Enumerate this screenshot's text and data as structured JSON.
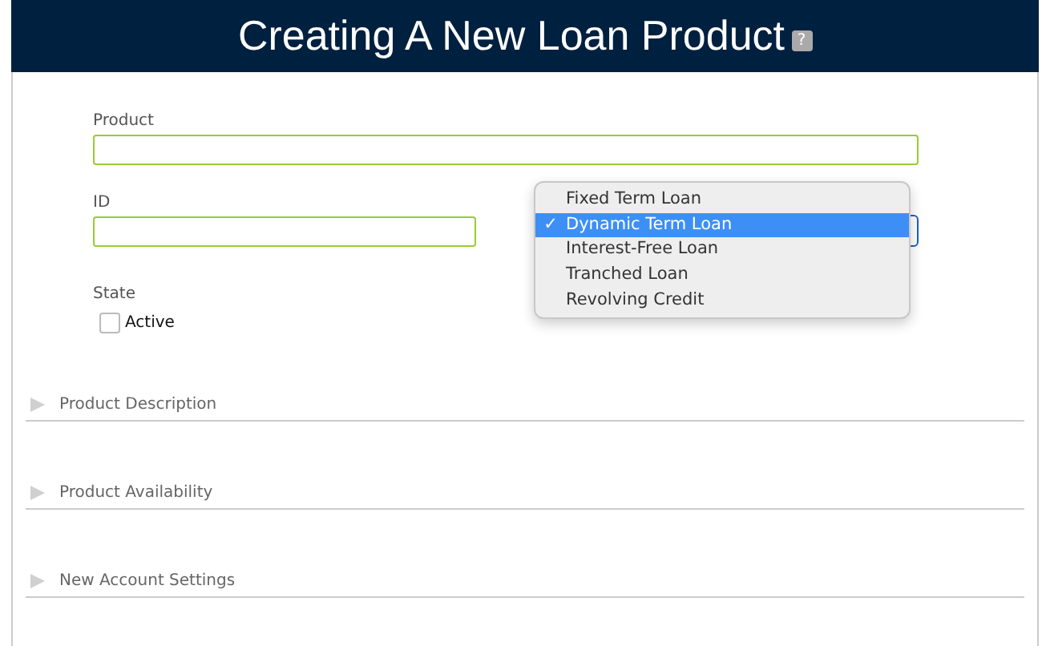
{
  "header": {
    "title": "Creating A New Loan Product",
    "help_icon": "?"
  },
  "fields": [
    {
      "label": "Product",
      "kind": "wide"
    },
    {
      "label": "ID",
      "kind": "narrow"
    }
  ],
  "product_type_menu": {
    "options": [
      {
        "label": "Fixed Term Loan",
        "selected": false
      },
      {
        "label": "Dynamic Term Loan",
        "selected": true
      },
      {
        "label": "Interest-Free Loan",
        "selected": false
      },
      {
        "label": "Tranched Loan",
        "selected": false
      },
      {
        "label": "Revolving Credit",
        "selected": false
      }
    ],
    "check_mark": "✓"
  },
  "state": {
    "label": "State",
    "option": {
      "label": "Active",
      "checked": false
    }
  },
  "sections": [
    {
      "title": "Product Description",
      "expanded": false
    },
    {
      "title": "Product Availability",
      "expanded": false
    },
    {
      "title": "New Account Settings",
      "expanded": false
    }
  ]
}
